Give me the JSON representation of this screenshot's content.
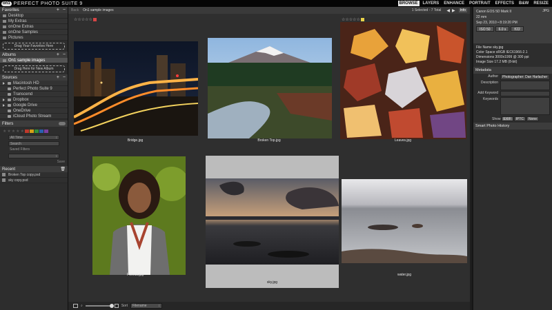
{
  "app": {
    "logo_mark": "on1",
    "title": "PERFECT PHOTO SUITE 9",
    "modules": [
      "BROWSE",
      "LAYERS",
      "ENHANCE",
      "PORTRAIT",
      "EFFECTS",
      "B&W",
      "RESIZE"
    ],
    "active_module": "BROWSE"
  },
  "favorites": {
    "title": "Favorites",
    "items": [
      "Desktop",
      "My Extras",
      "onOne Extras",
      "onOne Samples",
      "Pictures"
    ],
    "drop_label": "Drag Your Favorites Here"
  },
  "albums": {
    "title": "Albums",
    "items": [
      "On1 sample images"
    ],
    "drop_label": "Drag Here for New Album"
  },
  "sources": {
    "title": "Sources",
    "items": [
      "Macintosh HD",
      "Perfect Photo Suite 9",
      "Transcend",
      "Dropbox",
      "Google Drive",
      "OneDrive",
      "iCloud Photo Stream"
    ]
  },
  "filters": {
    "title": "Filters",
    "date_value": "All Time",
    "search_placeholder": "Search",
    "saved_label": "Saved Filters",
    "save_label": "Save",
    "swatch_colors": [
      "#c0392b",
      "#d4a017",
      "#2f8f3a",
      "#2a5fb0",
      "#7b3fa0"
    ]
  },
  "recent": {
    "title": "Recent",
    "items": [
      "Broken Top copy.psd",
      "sky copy.psd"
    ]
  },
  "nav": {
    "back": "Back",
    "path": "On1 sample images",
    "count": "1 Selected - 7 Total",
    "info": "Info"
  },
  "grid": {
    "items": [
      {
        "filename": "Bridge.jpg",
        "rating": "☆☆☆☆☆",
        "label_color": "#d64545"
      },
      {
        "filename": "Broken Top.jpg",
        "rating": "",
        "label_color": ""
      },
      {
        "filename": "Leaves.jpg",
        "rating": "☆☆☆☆☆",
        "label_color": "#e8d24a"
      },
      {
        "filename": "Portrait.jpg",
        "rating": "",
        "label_color": ""
      },
      {
        "filename": "sky.jpg",
        "rating": "",
        "label_color": ""
      },
      {
        "filename": "water.jpg",
        "rating": "",
        "label_color": ""
      }
    ]
  },
  "bottom": {
    "sort_label": "Sort",
    "sort_value": "Filename"
  },
  "info_panel": {
    "camera": "Canon EOS 5D Mark II",
    "format": "JPG",
    "focal": "22 mm",
    "date": "Sep 23, 2010 • 8:19:20 PM",
    "iso": "ISO 50",
    "exposure": "6.0 s",
    "aperture": "f/22",
    "file_name": "File Name sky.jpg",
    "color_space": "Color Space sRGB IEC61966-2.1",
    "dimensions": "Dimensions 3000x1999 @ 300 ppi",
    "image_size": "Image Size 17.2 MB (8-bit)"
  },
  "metadata": {
    "title": "Metadata",
    "author_label": "Author",
    "author_value": "Photographer: Dan Harlacher",
    "description_label": "Description",
    "add_keyword_label": "Add Keyword",
    "keywords_label": "Keywords",
    "show_label": "Show",
    "show_options": [
      "EXIF",
      "IPTC",
      "None"
    ]
  },
  "smart_history": {
    "title": "Smart Photo History"
  }
}
